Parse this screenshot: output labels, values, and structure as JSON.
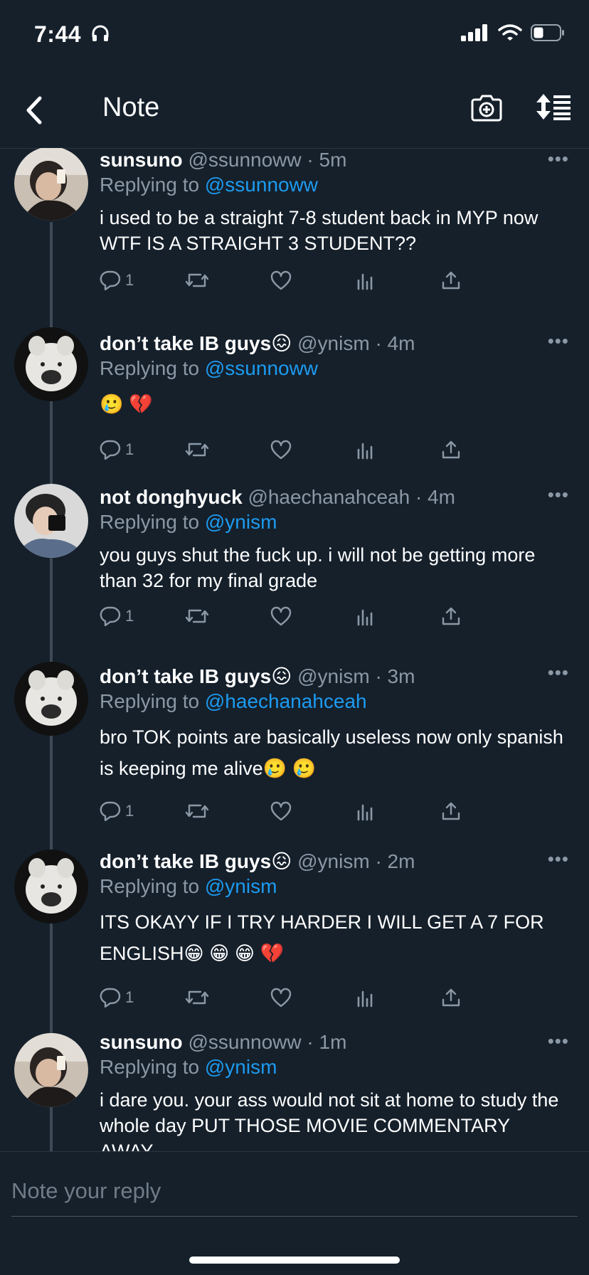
{
  "status": {
    "time": "7:44"
  },
  "nav": {
    "title": "Note"
  },
  "composer": {
    "placeholder": "Note your reply"
  },
  "tweets": [
    {
      "name": "sunsuno",
      "handle": "@ssunnoww",
      "time": "· 5m",
      "reply_label": "Replying to",
      "reply_to": "@ssunnoww",
      "text": "i used to be a straight 7-8 student back in MYP now WTF IS A STRAIGHT 3 STUDENT??",
      "reply_count": "1"
    },
    {
      "name": "don’t take IB guys😖",
      "handle": "@ynism",
      "time": "· 4m",
      "reply_label": "Replying to",
      "reply_to": "@ssunnoww",
      "text": "🥲 💔",
      "reply_count": "1"
    },
    {
      "name": "not donghyuck",
      "handle": "@haechanahceah",
      "time": "· 4m",
      "reply_label": "Replying to",
      "reply_to": "@ynism",
      "text": "you guys shut the fuck up. i will not be getting more than 32 for my final grade",
      "reply_count": "1"
    },
    {
      "name": "don’t take IB guys😖",
      "handle": "@ynism",
      "time": "· 3m",
      "reply_label": "Replying to",
      "reply_to": "@haechanahceah",
      "text": "bro TOK points are basically useless now only spanish is keeping me alive🥲 🥲",
      "reply_count": "1"
    },
    {
      "name": "don’t take IB guys😖",
      "handle": "@ynism",
      "time": "· 2m",
      "reply_label": "Replying to",
      "reply_to": "@ynism",
      "text": "ITS OKAYY IF I TRY HARDER I WILL GET A 7 FOR ENGLISH😁 😁 😁 💔",
      "reply_count": "1"
    },
    {
      "name": "sunsuno",
      "handle": "@ssunnoww",
      "time": "· 1m",
      "reply_label": "Replying to",
      "reply_to": "@ynism",
      "text": "i dare you. your ass would not sit at home to study the whole day PUT THOSE MOVIE COMMENTARY AWAY",
      "reply_count": ""
    }
  ]
}
